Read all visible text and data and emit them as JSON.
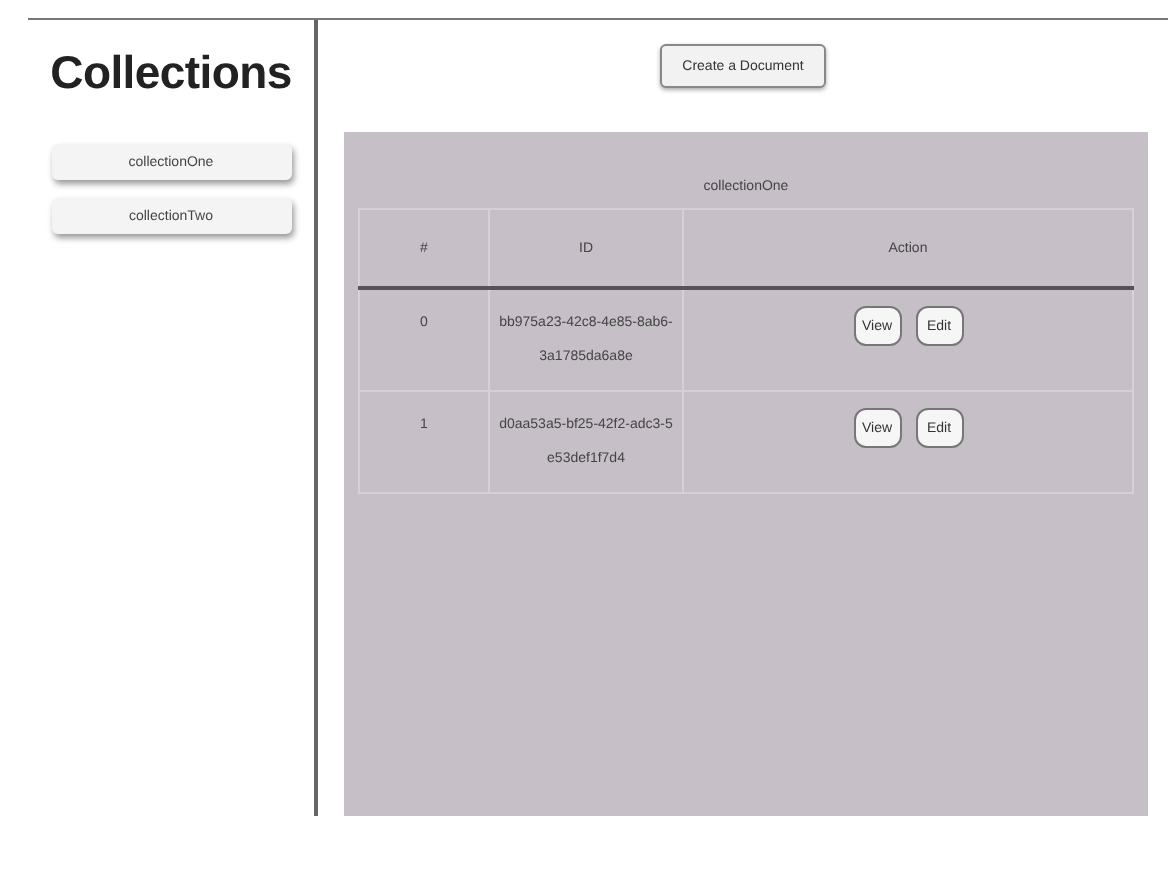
{
  "sidebar": {
    "title": "Collections",
    "items": [
      {
        "label": "collectionOne"
      },
      {
        "label": "collectionTwo"
      }
    ]
  },
  "create_button": "Create a Document",
  "table": {
    "title": "collectionOne",
    "columns": [
      "#",
      "ID",
      "Action"
    ],
    "rows": [
      {
        "index": "0",
        "id": "bb975a23-42c8-4e85-8ab6-3a1785da6a8e",
        "actions": [
          "View",
          "Edit"
        ]
      },
      {
        "index": "1",
        "id": "d0aa53a5-bf25-42f2-adc3-5e53def1f7d4",
        "actions": [
          "View",
          "Edit"
        ]
      }
    ]
  }
}
